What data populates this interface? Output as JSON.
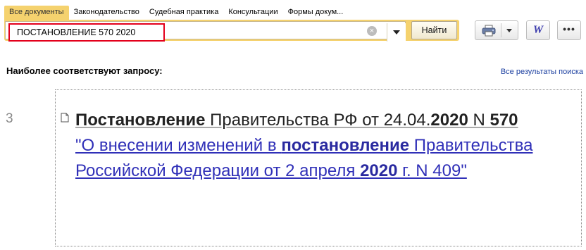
{
  "tabs": [
    {
      "label": "Все документы",
      "active": true
    },
    {
      "label": "Законодательство"
    },
    {
      "label": "Судебная практика"
    },
    {
      "label": "Консультации"
    },
    {
      "label": "Формы докум..."
    }
  ],
  "search": {
    "value": "ПОСТАНОВЛЕНИЕ 570 2020",
    "find_label": "Найти"
  },
  "toolbar": {
    "print_icon": "printer-icon",
    "word_label": "W",
    "more_label": "•••"
  },
  "results": {
    "section_title": "Наиболее соответствуют запросу:",
    "all_results_link": "Все результаты поиска",
    "items": [
      {
        "number": "3",
        "head_bold_1": "Постановление",
        "head_text_1": " Правительства РФ от 24.04.",
        "head_bold_2": "2020",
        "head_text_2": " N ",
        "head_bold_3": "570",
        "link_text_1": "\"О внесении изменений в ",
        "link_bold_1": "постановление",
        "link_text_2": " Правительства Российской Федерации от 2 апреля ",
        "link_bold_2": "2020",
        "link_text_3": " г. N 409\""
      }
    ]
  },
  "colors": {
    "accent": "#f5d26e",
    "highlight_border": "#e3001b",
    "link": "#3030b8"
  }
}
